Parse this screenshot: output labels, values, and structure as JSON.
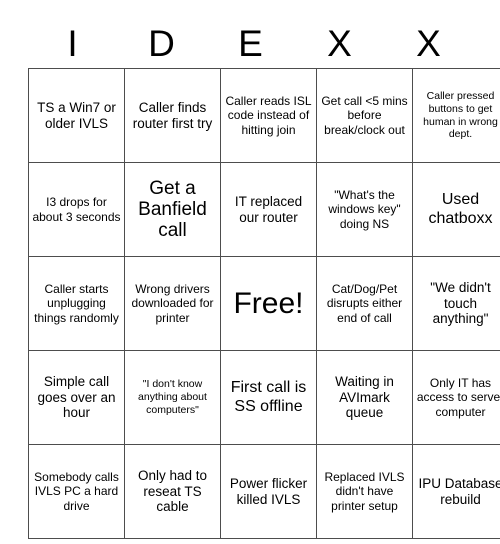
{
  "card": {
    "title_letters": [
      "I",
      "D",
      "E",
      "X",
      "X"
    ],
    "rows": [
      [
        {
          "text": "TS a Win7 or older IVLS",
          "size": "md"
        },
        {
          "text": "Caller finds router first try",
          "size": "md"
        },
        {
          "text": "Caller reads ISL code instead of hitting join",
          "size": "sm"
        },
        {
          "text": "Get call <5 mins before break/clock out",
          "size": "sm"
        },
        {
          "text": "Caller pressed buttons to get human in wrong dept.",
          "size": "xs"
        }
      ],
      [
        {
          "text": "I3 drops for about 3 seconds",
          "size": "sm"
        },
        {
          "text": "Get a Banfield call",
          "size": "xl"
        },
        {
          "text": "IT replaced our router",
          "size": "md"
        },
        {
          "text": "\"What's the windows key\" doing NS",
          "size": "sm"
        },
        {
          "text": "Used chatboxx",
          "size": "lg"
        }
      ],
      [
        {
          "text": "Caller starts unplugging things randomly",
          "size": "sm"
        },
        {
          "text": "Wrong drivers downloaded for printer",
          "size": "sm"
        },
        {
          "text": "Free!",
          "size": "free"
        },
        {
          "text": "Cat/Dog/Pet disrupts either end of call",
          "size": "sm"
        },
        {
          "text": "\"We didn't touch anything\"",
          "size": "md"
        }
      ],
      [
        {
          "text": "Simple call goes over an hour",
          "size": "md"
        },
        {
          "text": "\"I don't know anything about computers\"",
          "size": "xs"
        },
        {
          "text": "First call is SS offline",
          "size": "lg"
        },
        {
          "text": "Waiting in AVImark queue",
          "size": "md"
        },
        {
          "text": "Only IT has access to server computer",
          "size": "sm"
        }
      ],
      [
        {
          "text": "Somebody calls IVLS PC a hard drive",
          "size": "sm"
        },
        {
          "text": "Only had to reseat TS cable",
          "size": "md"
        },
        {
          "text": "Power flicker killed IVLS",
          "size": "md"
        },
        {
          "text": "Replaced IVLS didn't have printer setup",
          "size": "sm"
        },
        {
          "text": "IPU Database rebuild",
          "size": "md"
        }
      ]
    ]
  }
}
